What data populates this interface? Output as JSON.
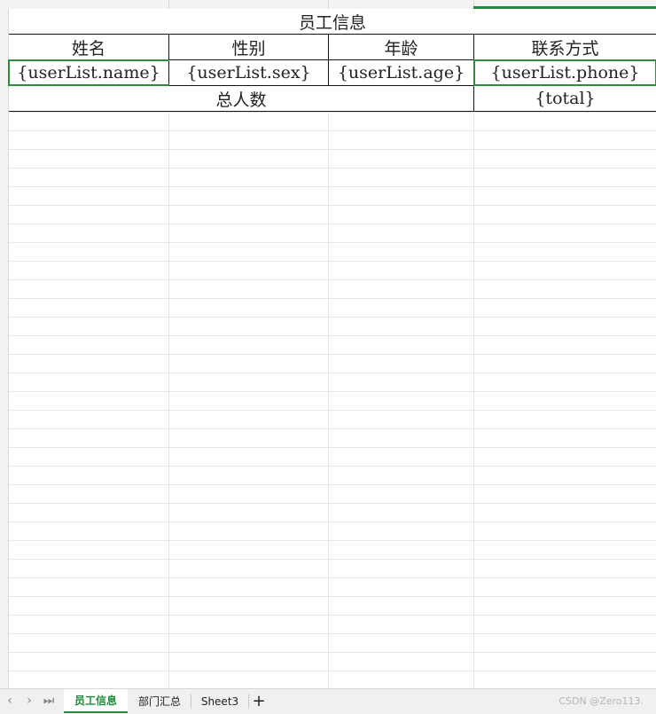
{
  "sheet_title": "员工信息",
  "headers": [
    "姓名",
    "性别",
    "年龄",
    "联系方式"
  ],
  "row_template": [
    "{userList.name}",
    "{userList.sex}",
    "{userList.age}",
    "{userList.phone}"
  ],
  "total_label": "总人数",
  "total_value": "{total}",
  "tabs": [
    {
      "label": "员工信息",
      "active": true
    },
    {
      "label": "部门汇总",
      "active": false
    },
    {
      "label": "Sheet3",
      "active": false
    }
  ],
  "tab_nav": [
    "‹",
    "›",
    "⏭"
  ],
  "add_tab": "+",
  "watermark": "CSDN @Zero113."
}
